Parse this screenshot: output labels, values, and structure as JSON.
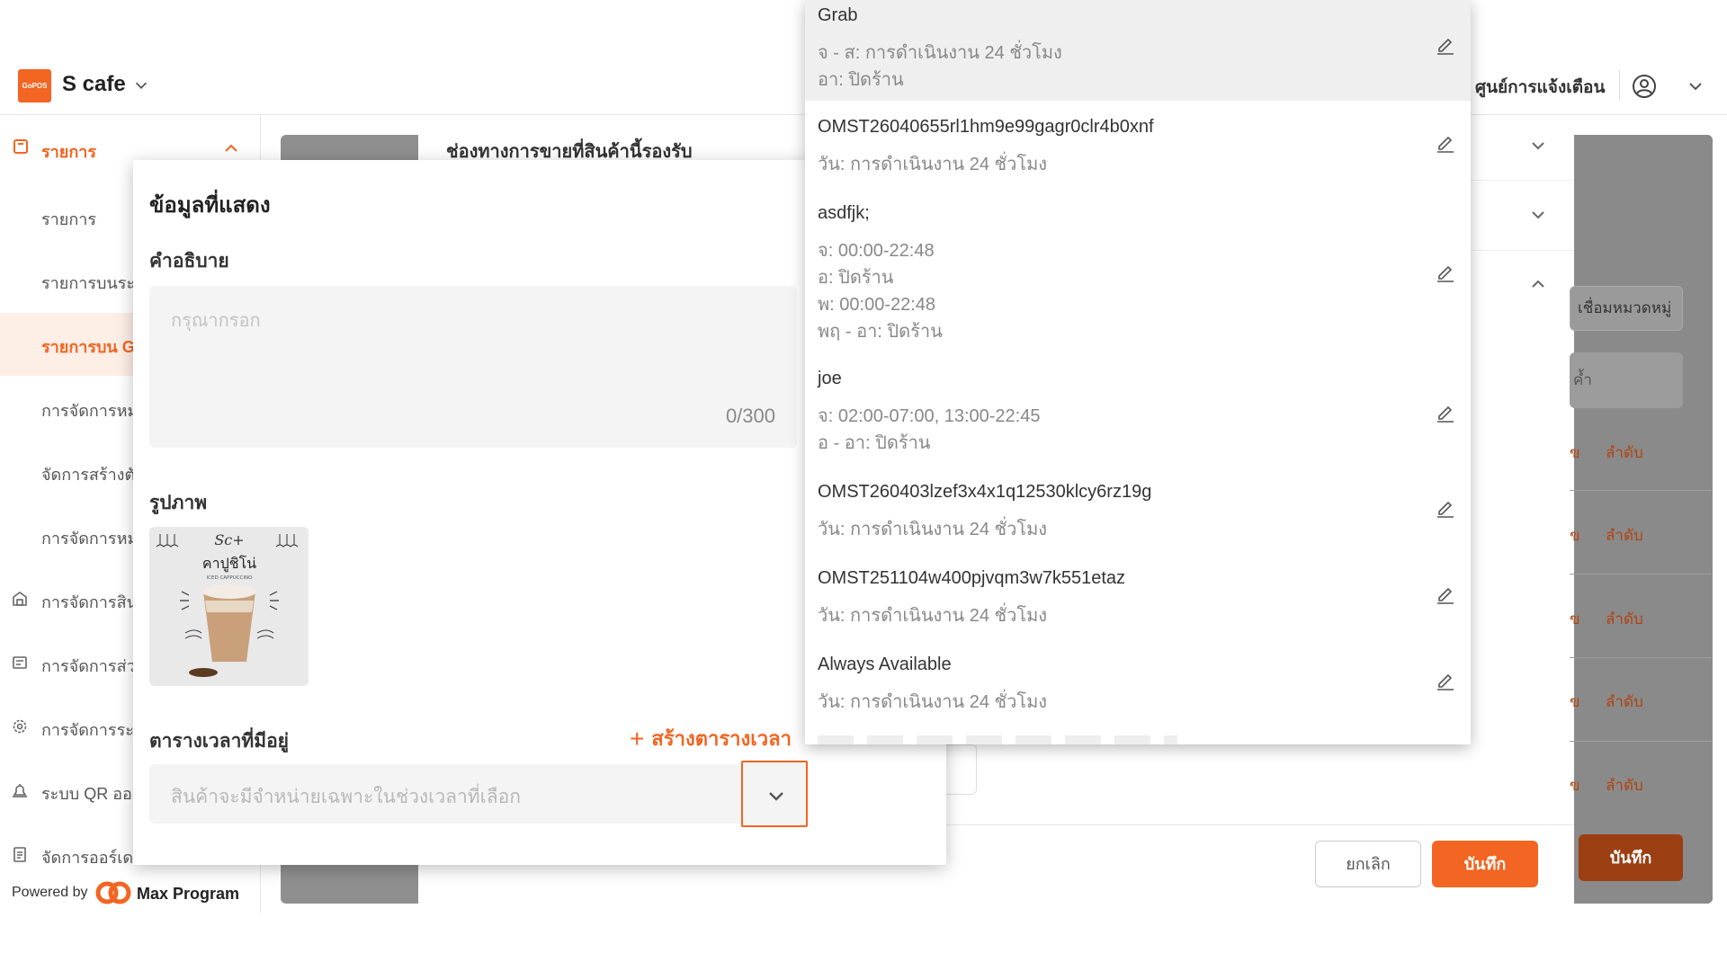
{
  "header": {
    "logo_text": "GoPOS",
    "store_name": "S cafe",
    "notification_label": "ศูนย์การแจ้งเตือน"
  },
  "sidebar": {
    "top_item": "รายการ",
    "items": [
      {
        "label": "รายการ",
        "active": false
      },
      {
        "label": "รายการบนระ",
        "active": false
      },
      {
        "label": "รายการบน G",
        "active": true
      },
      {
        "label": "การจัดการหม",
        "active": false
      },
      {
        "label": "จัดการสร้างตั",
        "active": false
      },
      {
        "label": "การจัดการหม",
        "active": false
      },
      {
        "label": "การจัดการสิน",
        "active": false,
        "icon": "store-icon"
      },
      {
        "label": "การจัดการส่ว",
        "active": false,
        "icon": "ticket-icon"
      },
      {
        "label": "การจัดการระ",
        "active": false,
        "icon": "settings-icon"
      },
      {
        "label": "ระบบ QR ออ",
        "active": false,
        "icon": "bell-icon"
      },
      {
        "label": "จัดการออร์เด",
        "active": false,
        "icon": "clipboard-icon"
      }
    ],
    "powered_by": "Powered by",
    "brand": "Max Program"
  },
  "behind": {
    "section_title": "ช่องทางการขายที่สินค้านี้รองรับ",
    "category_button": "เชื่อมหมวดหมู่",
    "search_fragment": "ค้ำ",
    "edit_fragment": "ข",
    "order_label": "ลำดับ",
    "cancel_label": "ยกเลิก",
    "save_label": "บันทึก",
    "outer_save_label": "บันทึก"
  },
  "modal": {
    "title": "ข้อมูลที่แสดง",
    "description_label": "คำอธิบาย",
    "description_placeholder": "กรุณากรอก",
    "description_counter": "0/300",
    "image_label": "รูปภาพ",
    "image_caption": "คาปูชิโน่",
    "image_brand": "Sc+",
    "image_subcaption": "ICED CAPPUCCINO",
    "schedule_label": "ตารางเวลาที่มีอยู่",
    "create_schedule_label": "สร้างตารางเวลา",
    "schedule_placeholder": "สินค้าจะมีจำหน่ายเฉพาะในช่วงเวลาที่เลือก"
  },
  "dropdown": {
    "items": [
      {
        "name": "Grab",
        "lines": [
          "จ - ส: การดำเนินงาน 24 ชั่วโมง",
          "อา: ปิดร้าน"
        ]
      },
      {
        "name": "OMST26040655rl1hm9e99gagr0clr4b0xnf",
        "lines": [
          "วัน: การดำเนินงาน 24 ชั่วโมง"
        ]
      },
      {
        "name": "asdfjk;",
        "lines": [
          "จ: 00:00-22:48",
          "อ: ปิดร้าน",
          "พ: 00:00-22:48",
          "พฤ - อา: ปิดร้าน"
        ]
      },
      {
        "name": "joe",
        "lines": [
          "จ: 02:00-07:00, 13:00-22:45",
          "อ - อา: ปิดร้าน"
        ]
      },
      {
        "name": "OMST260403lzef3x4x1q12530klcy6rz19g",
        "lines": [
          "วัน: การดำเนินงาน 24 ชั่วโมง"
        ]
      },
      {
        "name": "OMST251104w400pjvqm3w7k551etaz",
        "lines": [
          "วัน: การดำเนินงาน 24 ชั่วโมง"
        ]
      },
      {
        "name": "Always Available",
        "lines": [
          "วัน: การดำเนินงาน 24 ชั่วโมง"
        ]
      }
    ]
  },
  "colors": {
    "accent": "#f26522",
    "active_bg": "#fdeee6"
  }
}
